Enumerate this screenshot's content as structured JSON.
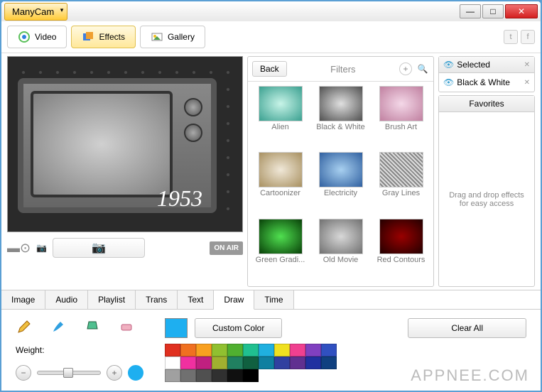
{
  "app_name": "ManyCam",
  "nav": {
    "video": "Video",
    "effects": "Effects",
    "gallery": "Gallery"
  },
  "preview": {
    "year": "1953",
    "onair": "ON AIR"
  },
  "filters": {
    "back": "Back",
    "title": "Filters",
    "items": [
      {
        "label": "Alien",
        "bg": "radial-gradient(#c8f4e8, #3aa090)"
      },
      {
        "label": "Black & White",
        "bg": "radial-gradient(#e0e0e0, #505050)"
      },
      {
        "label": "Brush Art",
        "bg": "radial-gradient(#f4d8e8, #c080a0)"
      },
      {
        "label": "Cartoonizer",
        "bg": "radial-gradient(#f0e8d8, #a89060)"
      },
      {
        "label": "Electricity",
        "bg": "radial-gradient(#a8d0f0, #3060a0)"
      },
      {
        "label": "Gray Lines",
        "bg": "repeating-linear-gradient(45deg,#ddd,#ddd 2px,#888 2px,#888 4px)"
      },
      {
        "label": "Green Gradi...",
        "bg": "radial-gradient(#50e050, #084008)"
      },
      {
        "label": "Old Movie",
        "bg": "radial-gradient(#d8d8d8, #707070)"
      },
      {
        "label": "Red Contours",
        "bg": "radial-gradient(#900, #200)"
      }
    ]
  },
  "selected": {
    "title": "Selected",
    "item": "Black & White"
  },
  "favorites": {
    "title": "Favorites",
    "hint": "Drag and drop effects for easy access"
  },
  "bottom_tabs": [
    "Image",
    "Audio",
    "Playlist",
    "Trans",
    "Text",
    "Draw",
    "Time"
  ],
  "draw": {
    "weight_label": "Weight:",
    "custom_color": "Custom Color",
    "clear_all": "Clear All",
    "current_color": "#1eaff0",
    "palette": [
      "#e03020",
      "#f07020",
      "#f8a020",
      "#90c030",
      "#50b030",
      "#20c090",
      "#20b0e0",
      "#f0e020",
      "#f04090",
      "#8040c0",
      "#3050c0",
      "#ffffff",
      "#f030a0",
      "#c02080",
      "#a0b030",
      "#208060",
      "#106040",
      "#1080a0",
      "#3040a0",
      "#603090",
      "#2030a0",
      "#104080",
      "#a0a0a0",
      "#707070",
      "#505050",
      "#303030",
      "#101010",
      "#000000"
    ]
  },
  "watermark": "APPNEE.COM"
}
